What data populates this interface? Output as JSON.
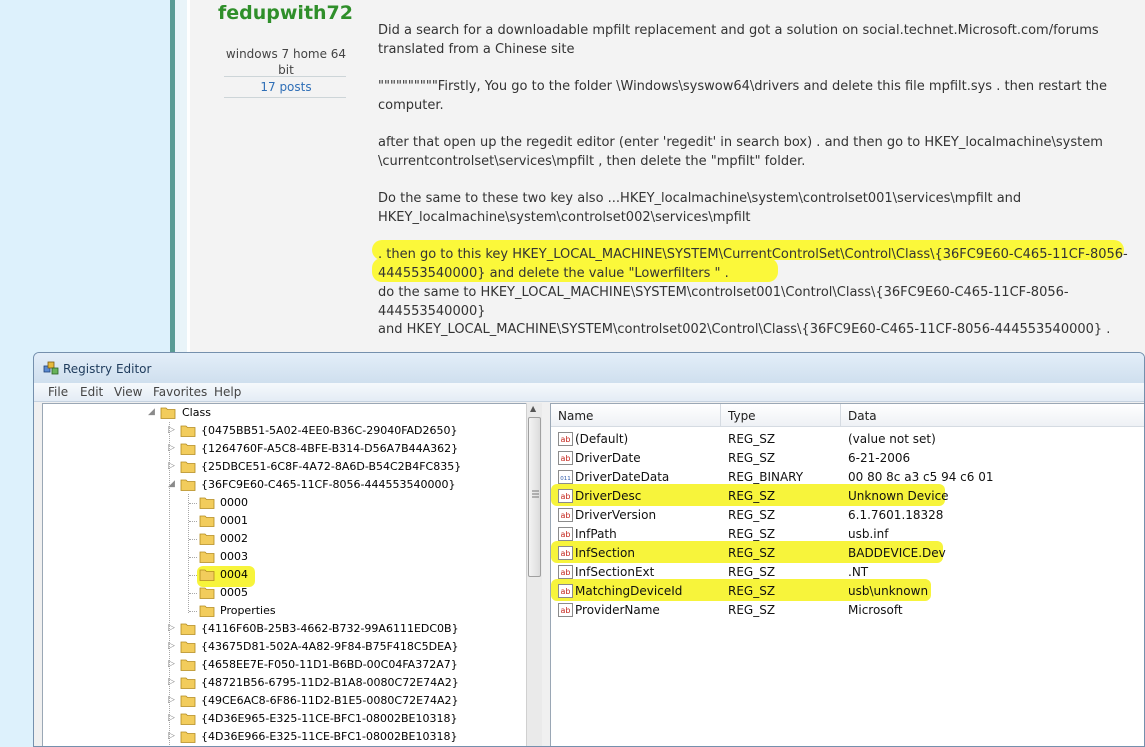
{
  "forum": {
    "author": "fedupwith72",
    "os": "windows 7 home 64 bit",
    "post_count": "17 posts",
    "paragraphs": [
      "Did a search for a downloadable mpfilt replacement and got a solution on social.technet.Microsoft.com/forums translated from a Chinese site",
      "\"\"\"\"\"\"\"\"\"\"Firstly, You go to the folder \\Windows\\syswow64\\drivers and delete this file mpfilt.sys . then restart the computer.",
      "after that open up the regedit editor (enter 'regedit' in search box) . and then go to HKEY_localmachine\\system \\currentcontrolset\\services\\mpfilt , then delete the \"mpfilt\" folder.",
      "Do the same to these two key also ...HKEY_localmachine\\system\\controlset001\\services\\mpfilt and HKEY_localmachine\\system\\controlset002\\services\\mpfilt",
      ". then go to this key HKEY_LOCAL_MACHINE\\SYSTEM\\CurrentControlSet\\Control\\Class\\{36FC9E60-C465-11CF-8056-444553540000} and delete the value \"Lowerfilters \" .",
      "do the same to HKEY_LOCAL_MACHINE\\SYSTEM\\controlset001\\Control\\Class\\{36FC9E60-C465-11CF-8056-444553540000}",
      "and HKEY_LOCAL_MACHINE\\SYSTEM\\controlset002\\Control\\Class\\{36FC9E60-C465-11CF-8056-444553540000} ."
    ],
    "highlight_color": "#fbf83a"
  },
  "regedit": {
    "title": "Registry Editor",
    "menu": [
      "File",
      "Edit",
      "View",
      "Favorites",
      "Help"
    ],
    "tree": {
      "root_label": "Class",
      "items": [
        "{0475BB51-5A02-4EE0-B36C-29040FAD2650}",
        "{1264760F-A5C8-4BFE-B314-D56A7B44A362}",
        "{25DBCE51-6C8F-4A72-8A6D-B54C2B4FC835}",
        "{36FC9E60-C465-11CF-8056-444553540000}",
        "0000",
        "0001",
        "0002",
        "0003",
        "0004",
        "0005",
        "Properties",
        "{4116F60B-25B3-4662-B732-99A6111EDC0B}",
        "{43675D81-502A-4A82-9F84-B75F418C5DEA}",
        "{4658EE7E-F050-11D1-B6BD-00C04FA372A7}",
        "{48721B56-6795-11D2-B1A8-0080C72E74A2}",
        "{49CE6AC8-6F86-11D2-B1E5-0080C72E74A2}",
        "{4D36E965-E325-11CE-BFC1-08002BE10318}",
        "{4D36E966-E325-11CE-BFC1-08002BE10318}"
      ],
      "selected": "0004"
    },
    "columns": [
      "Name",
      "Type",
      "Data"
    ],
    "values": [
      {
        "name": "(Default)",
        "type": "REG_SZ",
        "data": "(value not set)",
        "icon": "string-value-icon"
      },
      {
        "name": "DriverDate",
        "type": "REG_SZ",
        "data": "6-21-2006",
        "icon": "string-value-icon"
      },
      {
        "name": "DriverDateData",
        "type": "REG_BINARY",
        "data": "00 80 8c a3 c5 94 c6 01",
        "icon": "binary-value-icon"
      },
      {
        "name": "DriverDesc",
        "type": "REG_SZ",
        "data": "Unknown Device",
        "icon": "string-value-icon"
      },
      {
        "name": "DriverVersion",
        "type": "REG_SZ",
        "data": "6.1.7601.18328",
        "icon": "string-value-icon"
      },
      {
        "name": "InfPath",
        "type": "REG_SZ",
        "data": "usb.inf",
        "icon": "string-value-icon"
      },
      {
        "name": "InfSection",
        "type": "REG_SZ",
        "data": "BADDEVICE.Dev",
        "icon": "string-value-icon"
      },
      {
        "name": "InfSectionExt",
        "type": "REG_SZ",
        "data": ".NT",
        "icon": "string-value-icon"
      },
      {
        "name": "MatchingDeviceId",
        "type": "REG_SZ",
        "data": "usb\\unknown",
        "icon": "string-value-icon"
      },
      {
        "name": "ProviderName",
        "type": "REG_SZ",
        "data": "Microsoft",
        "icon": "string-value-icon"
      }
    ],
    "highlighted_rows": [
      "DriverDesc",
      "InfSection",
      "MatchingDeviceId"
    ],
    "highlight_color": "#f7f43b"
  }
}
